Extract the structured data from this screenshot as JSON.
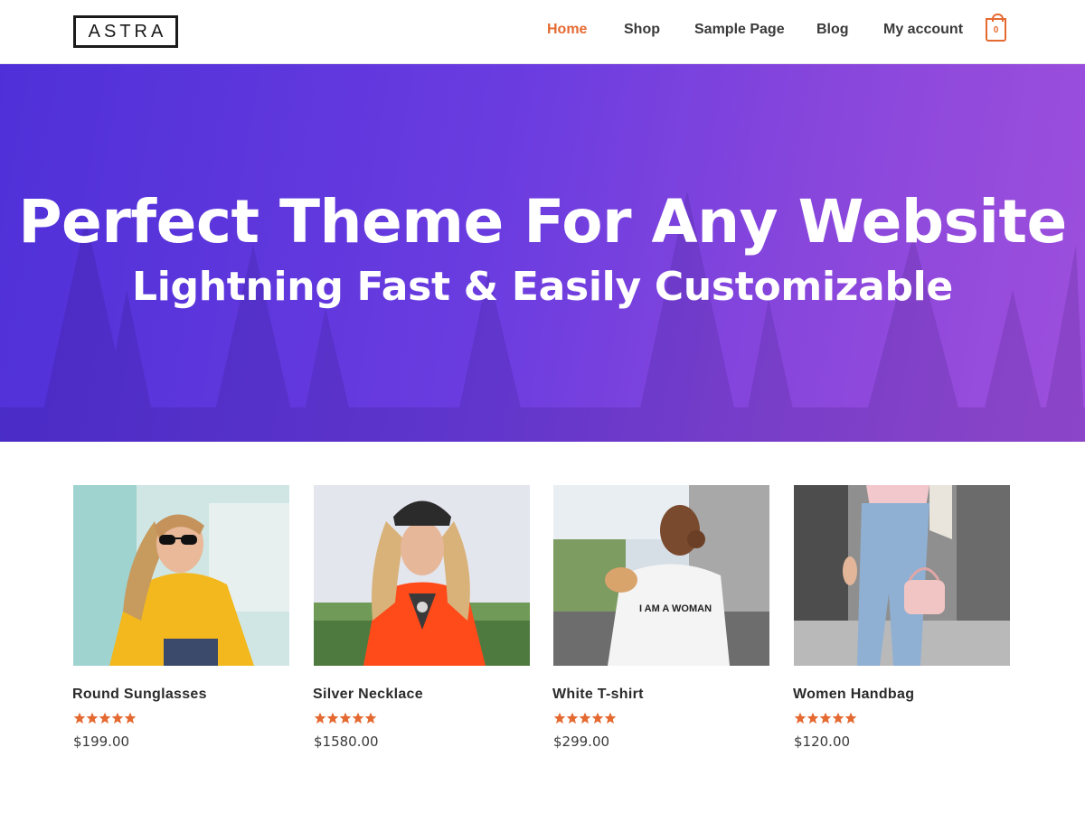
{
  "header": {
    "logo": "ASTRA",
    "nav": [
      {
        "label": "Home",
        "active": true
      },
      {
        "label": "Shop",
        "active": false
      },
      {
        "label": "Sample Page",
        "active": false
      },
      {
        "label": "Blog",
        "active": false
      },
      {
        "label": "My account",
        "active": false
      }
    ],
    "cart_count": "0",
    "accent_color": "#e56a32"
  },
  "hero": {
    "title": "Perfect Theme For Any Website",
    "subtitle": "Lightning Fast & Easily Customizable",
    "gradient": [
      "#4f30d8",
      "#9e4fdc"
    ]
  },
  "products": [
    {
      "name": "Round Sunglasses",
      "rating": 5,
      "price": "$199.00"
    },
    {
      "name": "Silver Necklace",
      "rating": 5,
      "price": "$1580.00"
    },
    {
      "name": "White T-shirt",
      "rating": 5,
      "price": "$299.00"
    },
    {
      "name": "Women Handbag",
      "rating": 5,
      "price": "$120.00"
    }
  ]
}
